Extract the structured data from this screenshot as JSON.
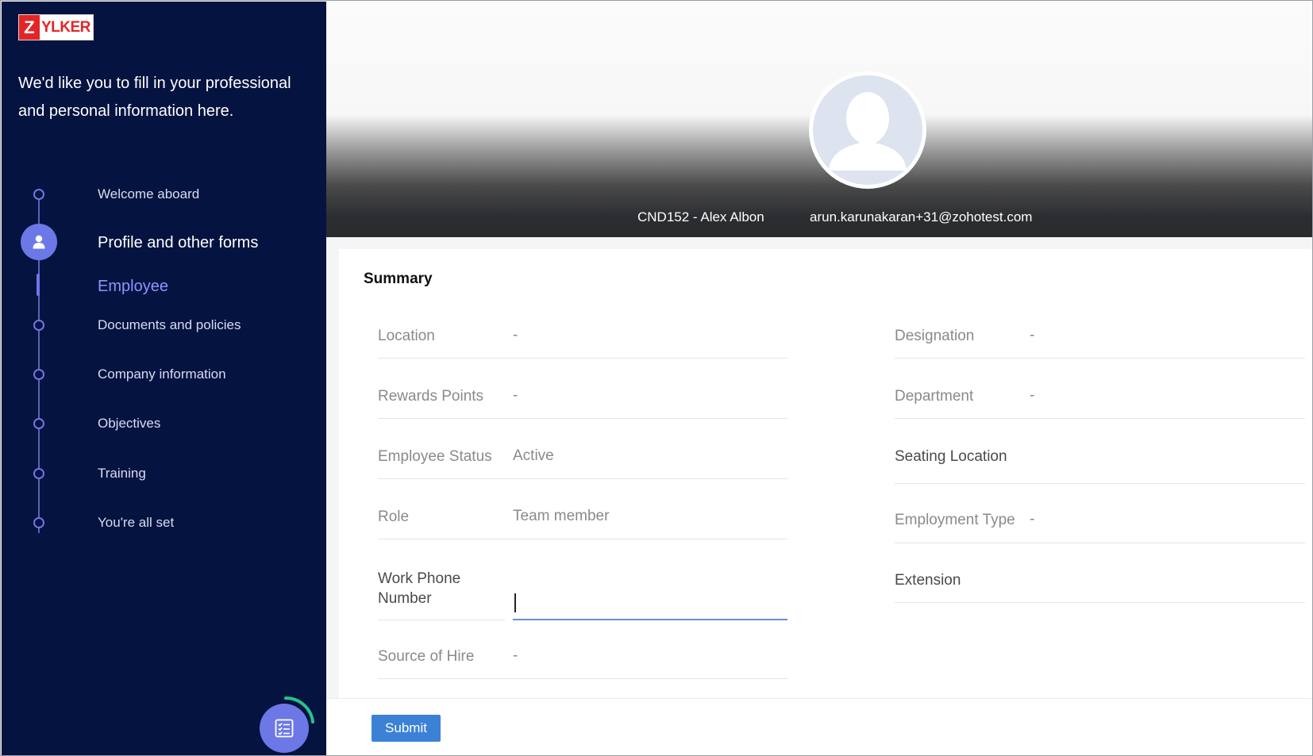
{
  "brand": {
    "logo_letter": "Z",
    "logo_text": "YLKER",
    "accent": "#e42527"
  },
  "intro_text": "We'd like you to fill in your professional and personal information here.",
  "steps": [
    {
      "label": "Welcome aboard"
    },
    {
      "label": "Profile and other forms"
    },
    {
      "label": "Documents and policies"
    },
    {
      "label": "Company information"
    },
    {
      "label": "Objectives"
    },
    {
      "label": "Training"
    },
    {
      "label": "You're all set"
    }
  ],
  "active_substep": "Employee",
  "header": {
    "employee_id_name": "CND152 - Alex Albon",
    "email": "arun.karunakaran+31@zohotest.com"
  },
  "summary": {
    "title": "Summary",
    "left_fields": [
      {
        "label": "Location",
        "value": "-"
      },
      {
        "label": "Rewards Points",
        "value": "-"
      },
      {
        "label": "Employee Status",
        "value": "Active"
      },
      {
        "label": "Role",
        "value": "Team member"
      },
      {
        "label": "Work Phone Number",
        "value": ""
      },
      {
        "label": "Source of Hire",
        "value": "-"
      }
    ],
    "right_fields": [
      {
        "label": "Designation",
        "value": "-"
      },
      {
        "label": "Department",
        "value": "-"
      },
      {
        "label": "Seating Location",
        "value": ""
      },
      {
        "label": "Employment Type",
        "value": "-"
      },
      {
        "label": "Extension",
        "value": ""
      }
    ]
  },
  "footer": {
    "submit_label": "Submit"
  },
  "colors": {
    "sidebar_bg": "#051340",
    "step_accent": "#6c78e6",
    "substep_text": "#8c96ff",
    "submit_bg": "#3b82d6"
  },
  "icons": {
    "active_step": "user-icon",
    "fab": "checklist-icon"
  }
}
